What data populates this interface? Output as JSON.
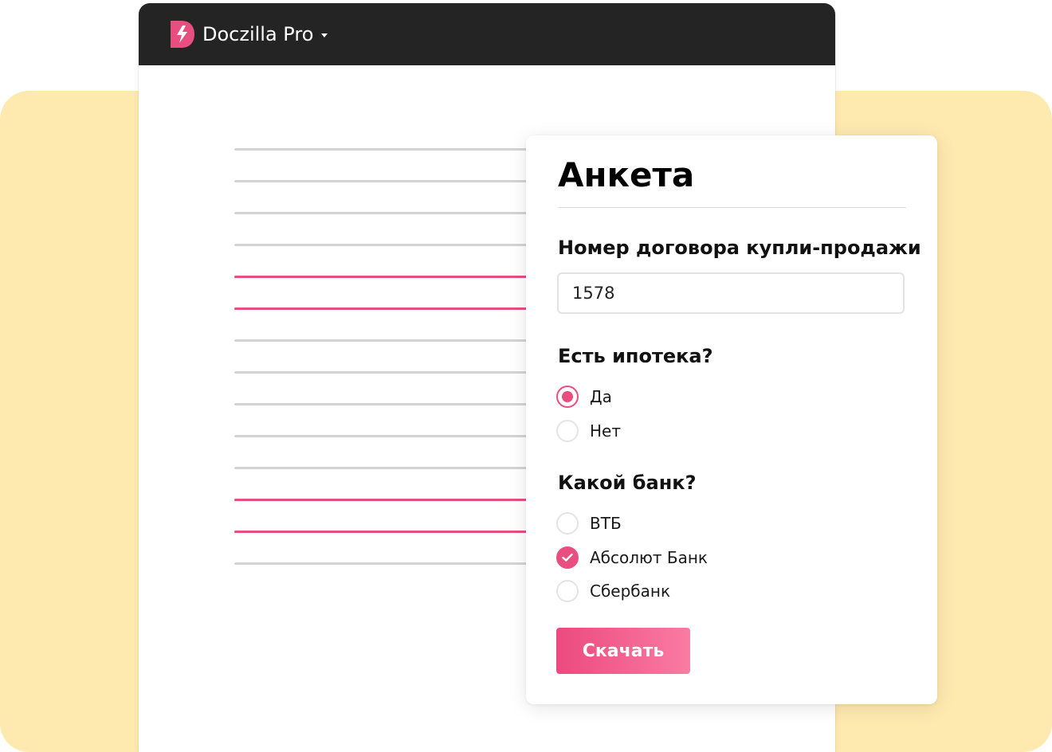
{
  "app": {
    "title": "Doczilla Pro",
    "logo_icon": "doczilla-logo-icon",
    "menu_icon": "caret-down-icon"
  },
  "document": {
    "lines": [
      {
        "color": "gray"
      },
      {
        "color": "gray"
      },
      {
        "color": "gray"
      },
      {
        "color": "gray"
      },
      {
        "color": "pink"
      },
      {
        "color": "pink"
      },
      {
        "color": "gray"
      },
      {
        "color": "gray"
      },
      {
        "color": "gray"
      },
      {
        "color": "gray"
      },
      {
        "color": "gray"
      },
      {
        "color": "pink"
      },
      {
        "color": "pink"
      },
      {
        "color": "gray"
      }
    ]
  },
  "form": {
    "title": "Анкета",
    "contract": {
      "label": "Номер договора купли-продажи",
      "value": "1578"
    },
    "mortgage": {
      "label": "Есть ипотека?",
      "options": [
        {
          "label": "Да",
          "selected": true
        },
        {
          "label": "Нет",
          "selected": false
        }
      ]
    },
    "bank": {
      "label": "Какой банк?",
      "options": [
        {
          "label": "ВТБ",
          "checked": false
        },
        {
          "label": "Абсолют Банк",
          "checked": true
        },
        {
          "label": "Сбербанк",
          "checked": false
        }
      ]
    },
    "download_label": "Скачать"
  },
  "colors": {
    "accent": "#E94E81",
    "background_panel": "#FEE9AF",
    "titlebar": "#242424"
  }
}
